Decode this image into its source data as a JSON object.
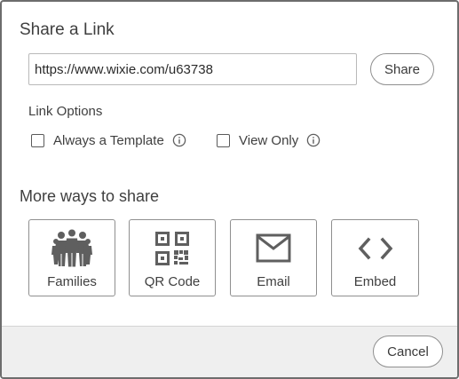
{
  "dialog": {
    "title": "Share a Link"
  },
  "link": {
    "url": "https://www.wixie.com/u63738",
    "share_label": "Share"
  },
  "link_options": {
    "heading": "Link Options",
    "options": [
      {
        "label": "Always a Template",
        "checked": false,
        "icon": "info-icon"
      },
      {
        "label": "View Only",
        "checked": false,
        "icon": "info-icon"
      }
    ]
  },
  "more_ways": {
    "heading": "More ways to share",
    "tiles": [
      {
        "label": "Families",
        "icon": "families-icon"
      },
      {
        "label": "QR Code",
        "icon": "qr-code-icon"
      },
      {
        "label": "Email",
        "icon": "email-icon"
      },
      {
        "label": "Embed",
        "icon": "embed-icon"
      }
    ]
  },
  "footer": {
    "cancel_label": "Cancel"
  },
  "colors": {
    "text": "#3f3f3f",
    "icon": "#5f5f5f",
    "border": "#8f8f8f",
    "footer_bg": "#efefef"
  }
}
